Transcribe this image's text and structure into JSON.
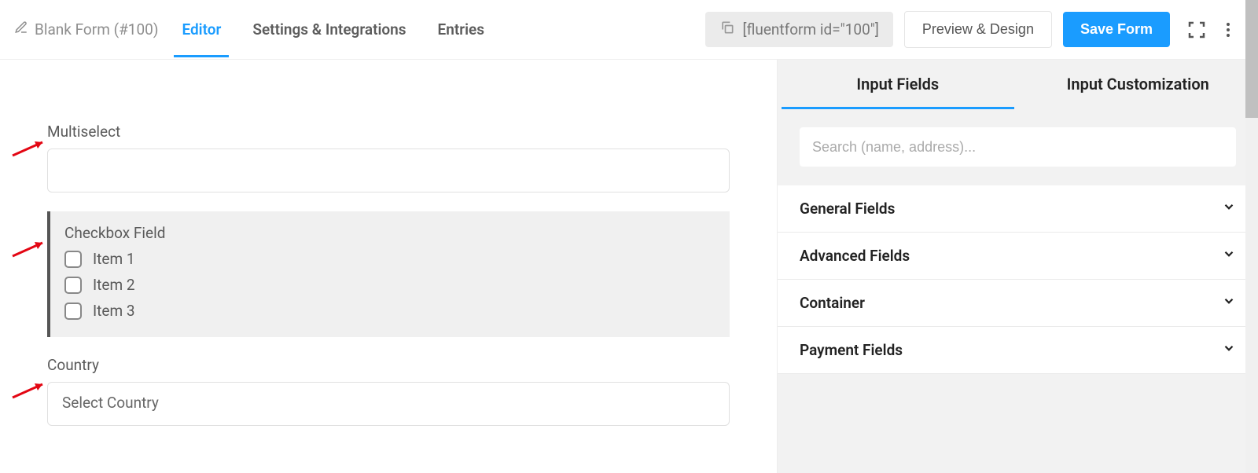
{
  "header": {
    "form_title": "Blank Form (#100)",
    "tabs": {
      "editor": "Editor",
      "settings": "Settings & Integrations",
      "entries": "Entries"
    },
    "shortcode": "[fluentform id=\"100\"]",
    "preview_btn": "Preview & Design",
    "save_btn": "Save Form"
  },
  "form": {
    "multiselect_label": "Multiselect",
    "checkbox_label": "Checkbox Field",
    "checkbox_items": [
      "Item 1",
      "Item 2",
      "Item 3"
    ],
    "country_label": "Country",
    "country_placeholder": "Select Country"
  },
  "sidebar": {
    "tabs": {
      "input_fields": "Input Fields",
      "customization": "Input Customization"
    },
    "search_placeholder": "Search (name, address)...",
    "sections": {
      "general": "General Fields",
      "advanced": "Advanced Fields",
      "container": "Container",
      "payment": "Payment Fields"
    }
  }
}
